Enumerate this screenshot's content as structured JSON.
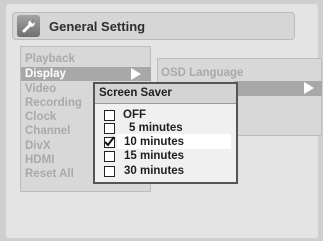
{
  "header": {
    "icon": "wrench-icon",
    "title": "General Setting"
  },
  "menu": {
    "items": [
      {
        "label": "Playback",
        "active": false
      },
      {
        "label": "Display",
        "active": true
      },
      {
        "label": "Video",
        "active": false
      },
      {
        "label": "Recording",
        "active": false
      },
      {
        "label": "Clock",
        "active": false
      },
      {
        "label": "Channel",
        "active": false
      },
      {
        "label": "DivX",
        "active": false
      },
      {
        "label": "HDMI",
        "active": false
      },
      {
        "label": "Reset All",
        "active": false
      }
    ]
  },
  "submenu": {
    "first_item": "OSD Language"
  },
  "popup": {
    "title": "Screen Saver",
    "options": [
      {
        "label": "OFF",
        "checked": false,
        "selected": false
      },
      {
        "label": "5 minutes",
        "checked": false,
        "selected": false
      },
      {
        "label": "10  minutes",
        "checked": true,
        "selected": true
      },
      {
        "label": "15  minutes",
        "checked": false,
        "selected": false
      },
      {
        "label": "30  minutes",
        "checked": false,
        "selected": false
      }
    ]
  },
  "colors": {
    "background": "#cfcfcf",
    "panel": "#d8d8d8",
    "highlight": "#a8a8a8",
    "popup": "#f0f0f0",
    "inactive_text": "#a9a9a9",
    "active_text": "#ffffff"
  }
}
